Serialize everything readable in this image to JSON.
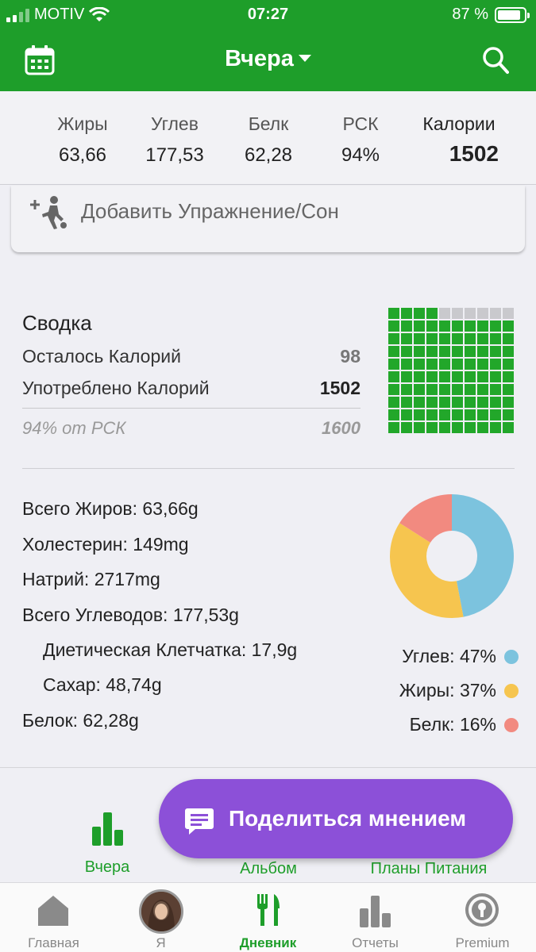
{
  "status_bar": {
    "carrier": "MOTIV",
    "time": "07:27",
    "battery": "87 %"
  },
  "header": {
    "title": "Вчера",
    "calendar_icon": "calendar-icon",
    "search_icon": "search-icon"
  },
  "macros": [
    {
      "label": "Жиры",
      "value": "63,66"
    },
    {
      "label": "Углев",
      "value": "177,53"
    },
    {
      "label": "Белк",
      "value": "62,28"
    },
    {
      "label": "РСК",
      "value": "94%"
    },
    {
      "label": "Калории",
      "value": "1502"
    }
  ],
  "exercise": {
    "label": "Добавить Упражнение/Сон",
    "icon": "add-exercise-icon"
  },
  "summary": {
    "title": "Сводка",
    "remaining_label": "Осталось Калорий",
    "remaining_value": "98",
    "consumed_label": "Употреблено Калорий",
    "consumed_value": "1502",
    "percent_label": "94% от РСК",
    "goal_value": "1600",
    "progress_fraction": 0.94
  },
  "nutrients": {
    "fat": "Всего Жиров: 63,66g",
    "cholesterol": "Холестерин: 149mg",
    "sodium": "Натрий: 2717mg",
    "carbs": "Всего Углеводов: 177,53g",
    "fiber": "Диетическая Клетчатка: 17,9g",
    "sugar": "Сахар: 48,74g",
    "protein": "Белок: 62,28g"
  },
  "macro_split": [
    {
      "label": "Углев: 47%",
      "percent": 47,
      "color": "#7cc3de"
    },
    {
      "label": "Жиры: 37%",
      "percent": 37,
      "color": "#f6c54f"
    },
    {
      "label": "Белк: 16%",
      "percent": 16,
      "color": "#f28a80"
    }
  ],
  "subtabs": {
    "yesterday": "Вчера",
    "album": "Альбом",
    "meal_plans": "Планы Питания"
  },
  "feedback_button": "Поделиться мнением",
  "bottom_nav": [
    {
      "label": "Главная",
      "icon": "home-icon"
    },
    {
      "label": "Я",
      "icon": "avatar"
    },
    {
      "label": "Дневник",
      "icon": "diary-icon"
    },
    {
      "label": "Отчеты",
      "icon": "reports-icon"
    },
    {
      "label": "Premium",
      "icon": "premium-icon"
    }
  ],
  "colors": {
    "brand_green": "#1e9e2a",
    "feedback_purple": "#8c50d8"
  }
}
